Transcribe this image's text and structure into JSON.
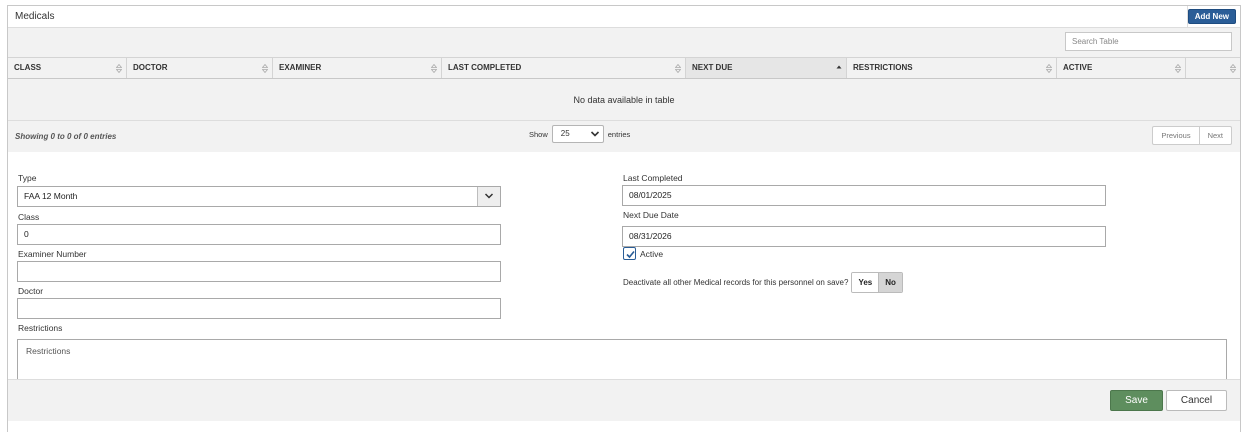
{
  "panel": {
    "title": "Medicals",
    "add_new_label": "Add New"
  },
  "table": {
    "search_placeholder": "Search Table",
    "columns": [
      {
        "label": "CLASS",
        "sorted": false
      },
      {
        "label": "DOCTOR",
        "sorted": false
      },
      {
        "label": "EXAMINER",
        "sorted": false
      },
      {
        "label": "LAST COMPLETED",
        "sorted": false
      },
      {
        "label": "NEXT DUE",
        "sorted": true,
        "direction": "asc"
      },
      {
        "label": "RESTRICTIONS",
        "sorted": false
      },
      {
        "label": "ACTIVE",
        "sorted": false
      },
      {
        "label": "",
        "sorted": false
      }
    ],
    "empty_message": "No data available in table",
    "info": "Showing 0 to 0 of 0 entries",
    "length_prefix": "Show",
    "length_value": "25",
    "length_suffix": "entries",
    "prev_label": "Previous",
    "next_label": "Next"
  },
  "form": {
    "type_label": "Type",
    "type_value": "FAA 12 Month",
    "class_label": "Class",
    "class_value": "0",
    "examiner_label": "Examiner Number",
    "examiner_value": "",
    "doctor_label": "Doctor",
    "doctor_value": "",
    "restrictions_label": "Restrictions",
    "restrictions_placeholder": "Restrictions",
    "last_completed_label": "Last Completed",
    "last_completed_value": "08/01/2025",
    "next_due_label": "Next Due Date",
    "next_due_value": "08/31/2026",
    "active_label": "Active",
    "active_checked": true,
    "deactivate_label": "Deactivate all other Medical records for this personnel on save?",
    "yes_label": "Yes",
    "no_label": "No",
    "deactivate_selected": "No"
  },
  "footer": {
    "save_label": "Save",
    "cancel_label": "Cancel"
  },
  "colors": {
    "primary": "#2a5d97",
    "save": "#5e8e5e",
    "zone_bg": "#f2f2f2"
  }
}
